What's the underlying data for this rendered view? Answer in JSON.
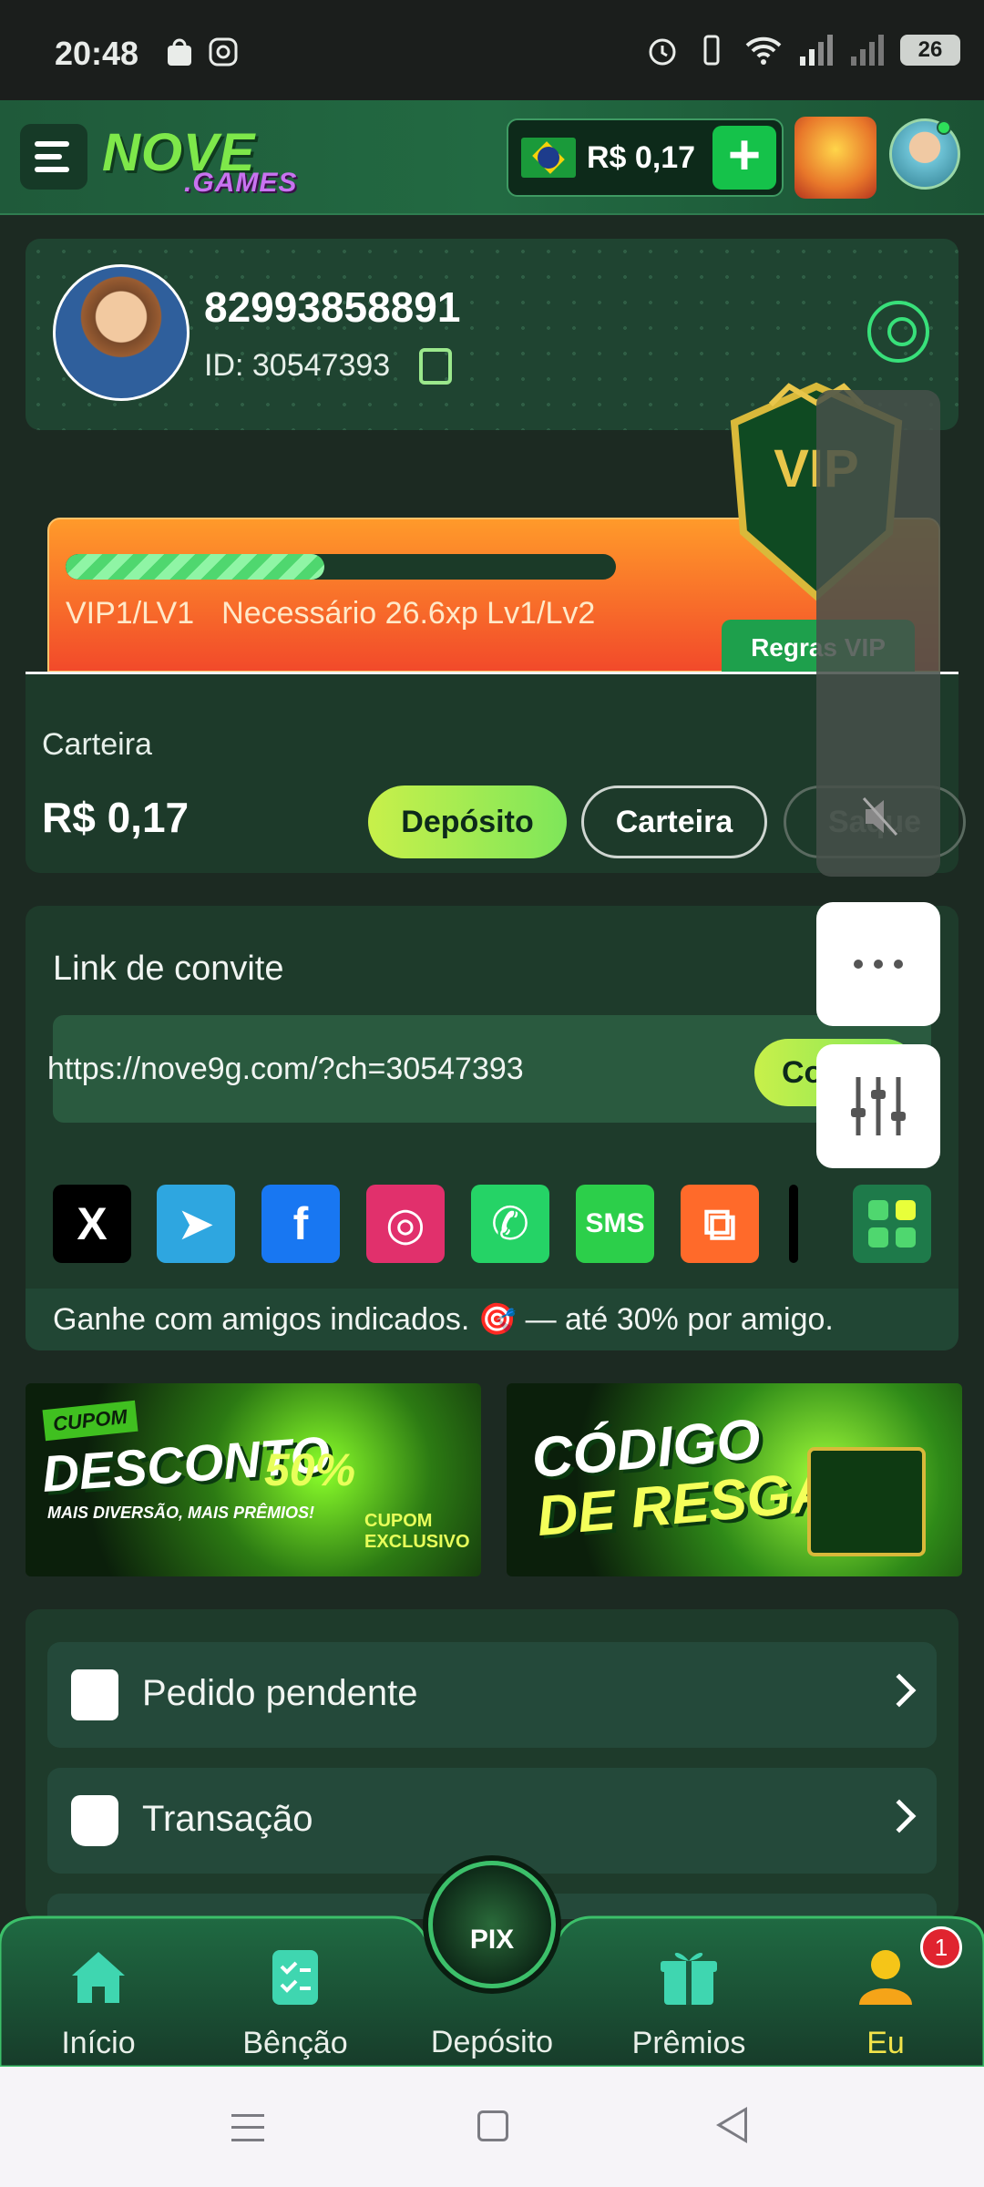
{
  "status_bar": {
    "time": "20:48",
    "battery": "26"
  },
  "header": {
    "logo_main": "NOVE",
    "logo_sub": ".GAMES",
    "balance": "R$ 0,17",
    "add_label": "+"
  },
  "profile": {
    "username": "82993858891",
    "id_text": "ID: 30547393"
  },
  "vip": {
    "progress": 0.47,
    "level": "VIP1/LV1",
    "required": "Necessário 26.6xp Lv1/Lv2",
    "rules_label": "Regras VIP",
    "badge_text": "VIP"
  },
  "wallet": {
    "label": "Carteira",
    "amount": "R$ 0,17",
    "deposit_label": "Depósito",
    "wallet_label": "Carteira",
    "withdraw_label": "Saque"
  },
  "invite": {
    "title": "Link de convite",
    "link": "https://nove9g.com/?ch=30547393",
    "copy_label": "Copiar",
    "socials": [
      {
        "name": "X",
        "label": "X",
        "color": "#000000"
      },
      {
        "name": "Telegram",
        "label": "➤",
        "color": "#2ea6e0"
      },
      {
        "name": "Facebook",
        "label": "f",
        "color": "#1877f2"
      },
      {
        "name": "Instagram",
        "label": "◎",
        "color": "#e1306c"
      },
      {
        "name": "WhatsApp",
        "label": "✆",
        "color": "#25d366"
      },
      {
        "name": "SMS",
        "label": "SMS",
        "color": "#2ccf4a"
      },
      {
        "name": "Kwai",
        "label": "⧉",
        "color": "#ff6a2a"
      }
    ],
    "footer": "Ganhe com amigos indicados. 🎯 — até 30% por amigo."
  },
  "banners": {
    "b1_small": "CUPOM",
    "b1_big": "DESCONTO",
    "b1_sub": "MAIS DIVERSÃO, MAIS PRÊMIOS!",
    "b1_pct": "50%",
    "b1_cupom": "CUPOM EXCLUSIVO",
    "b2_line1": "CÓDIGO",
    "b2_line2": "DE RESGATE"
  },
  "menu": [
    {
      "label": "Pedido pendente"
    },
    {
      "label": "Transação"
    }
  ],
  "bottom_nav": {
    "items": [
      {
        "label": "Início"
      },
      {
        "label": "Bênção"
      },
      {
        "label": "Depósito"
      },
      {
        "label": "Prêmios"
      },
      {
        "label": "Eu"
      }
    ],
    "pix_label": "PIX",
    "notification_count": "1"
  },
  "colors": {
    "accent": "#7ee65a",
    "background": "#1c2a22",
    "active_tab": "#f2e34a"
  }
}
